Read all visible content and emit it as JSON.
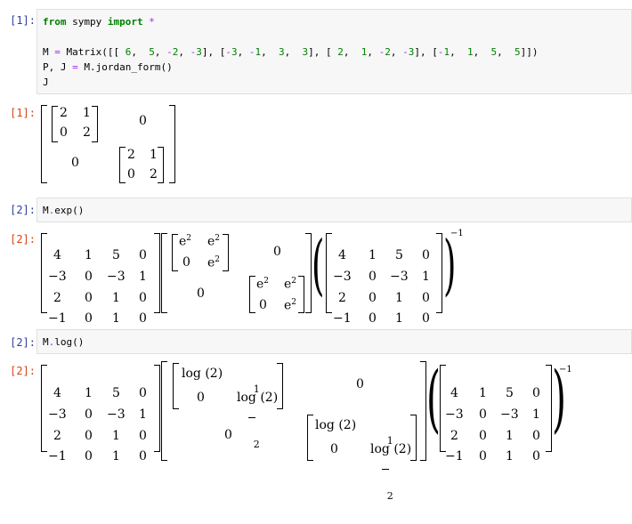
{
  "cells": [
    {
      "in_prompt": "[1]:",
      "code_lines": [
        "from sympy import *",
        "",
        "M = Matrix([[ 6,  5, -2, -3], [-3, -1,  3,  3], [ 2,  1, -2, -3], [-1,  1,  5,  5]])",
        "P, J = M.jordan_form()",
        "J"
      ],
      "out_prompt": "[1]:"
    },
    {
      "in_prompt": "[2]:",
      "code_lines": [
        "M.exp()"
      ],
      "out_prompt": "[2]:"
    },
    {
      "in_prompt": "[2]:",
      "code_lines": [
        "M.log()"
      ],
      "out_prompt": "[2]:"
    }
  ],
  "output1": {
    "block_a": [
      [
        "2",
        "1"
      ],
      [
        "0",
        "2"
      ]
    ],
    "zero_tr": "0",
    "zero_bl": "0",
    "block_b": [
      [
        "2",
        "1"
      ],
      [
        "0",
        "2"
      ]
    ]
  },
  "pmat": [
    [
      "4",
      "1",
      "5",
      "0"
    ],
    [
      "−3",
      "0",
      "−3",
      "1"
    ],
    [
      "2",
      "0",
      "1",
      "0"
    ],
    [
      "−1",
      "0",
      "1",
      "0"
    ]
  ],
  "exp_block": [
    [
      "e",
      "e"
    ],
    [
      "0",
      "e"
    ]
  ],
  "exp_sup": "2",
  "inv_sup": "−1",
  "zero": "0",
  "log_block": [
    [
      "log (2)",
      "1",
      "2"
    ],
    [
      "0",
      "log (2)"
    ]
  ],
  "colors": {
    "in_prompt": "#303f9f",
    "out_prompt": "#d84315",
    "keyword": "#008000",
    "cell_bg": "#f7f7f7"
  }
}
